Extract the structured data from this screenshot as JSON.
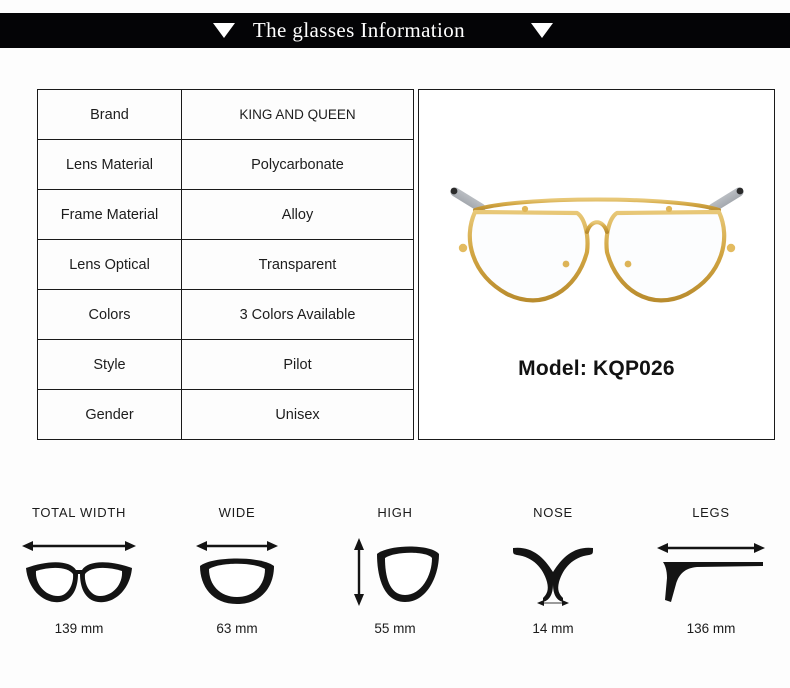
{
  "header": {
    "title": "The glasses Information",
    "left_marker_icon": "triangle-down-icon",
    "right_marker_icon": "triangle-down-icon",
    "background_color": "#040406",
    "text_color": "#ffffff"
  },
  "spec_table": {
    "rows": [
      {
        "key": "Brand",
        "value": "KING AND QUEEN"
      },
      {
        "key": "Lens Material",
        "value": "Polycarbonate"
      },
      {
        "key": "Frame Material",
        "value": "Alloy"
      },
      {
        "key": "Lens Optical",
        "value": "Transparent"
      },
      {
        "key": "Colors",
        "value": "3 Colors Available"
      },
      {
        "key": "Style",
        "value": "Pilot"
      },
      {
        "key": "Gender",
        "value": "Unisex"
      }
    ]
  },
  "product_photo": {
    "model_label": "Model: KQP026",
    "image_icon": "aviator-eyeglasses-photo",
    "frame_color": "#d9ad4e",
    "temple_color": "#b9bcc2"
  },
  "measurements": [
    {
      "label": "TOTAL WIDTH",
      "value": "139 mm",
      "icon": "glasses-total-width-icon"
    },
    {
      "label": "WIDE",
      "value": "63 mm",
      "icon": "lens-width-icon"
    },
    {
      "label": "HIGH",
      "value": "55 mm",
      "icon": "lens-height-icon"
    },
    {
      "label": "NOSE",
      "value": "14 mm",
      "icon": "nose-bridge-icon"
    },
    {
      "label": "LEGS",
      "value": "136 mm",
      "icon": "temple-arm-icon"
    }
  ]
}
